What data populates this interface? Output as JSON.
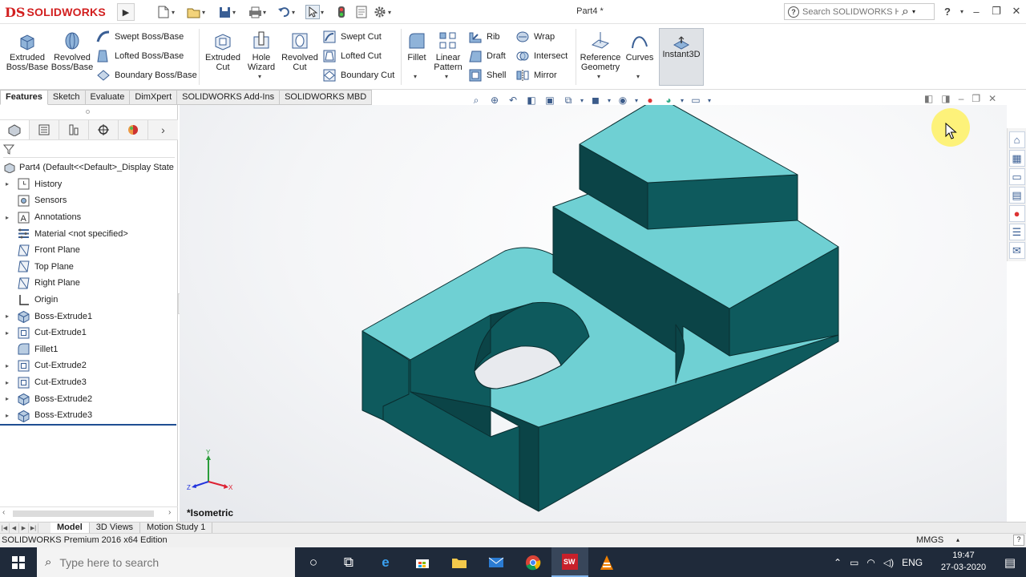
{
  "app": {
    "logo_ds": "DS",
    "logo_text": "SOLIDWORKS",
    "document_title": "Part4 *",
    "help_search_placeholder": "Search SOLIDWORKS Help",
    "help_label": "?",
    "accent_color": "#d21f1f"
  },
  "ribbon": {
    "extruded_boss": "Extruded\nBoss/Base",
    "revolved_boss": "Revolved\nBoss/Base",
    "swept_boss": "Swept Boss/Base",
    "lofted_boss": "Lofted Boss/Base",
    "boundary_boss": "Boundary Boss/Base",
    "extruded_cut": "Extruded\nCut",
    "hole_wizard": "Hole\nWizard",
    "revolved_cut": "Revolved\nCut",
    "swept_cut": "Swept Cut",
    "lofted_cut": "Lofted Cut",
    "boundary_cut": "Boundary Cut",
    "fillet": "Fillet",
    "linear_pattern": "Linear\nPattern",
    "rib": "Rib",
    "draft": "Draft",
    "shell": "Shell",
    "wrap": "Wrap",
    "intersect": "Intersect",
    "mirror": "Mirror",
    "reference_geometry": "Reference\nGeometry",
    "curves": "Curves",
    "instant3d": "Instant3D"
  },
  "tabs": [
    "Features",
    "Sketch",
    "Evaluate",
    "DimXpert",
    "SOLIDWORKS Add-Ins",
    "SOLIDWORKS MBD"
  ],
  "feature_tree": {
    "root": "Part4  (Default<<Default>_Display State",
    "items": [
      {
        "label": "History",
        "icon": "history-icon",
        "expandable": true
      },
      {
        "label": "Sensors",
        "icon": "sensors-icon",
        "expandable": false
      },
      {
        "label": "Annotations",
        "icon": "annotations-icon",
        "expandable": true
      },
      {
        "label": "Material <not specified>",
        "icon": "material-icon",
        "expandable": false
      },
      {
        "label": "Front Plane",
        "icon": "plane-icon",
        "expandable": false
      },
      {
        "label": "Top Plane",
        "icon": "plane-icon",
        "expandable": false
      },
      {
        "label": "Right Plane",
        "icon": "plane-icon",
        "expandable": false
      },
      {
        "label": "Origin",
        "icon": "origin-icon",
        "expandable": false
      },
      {
        "label": "Boss-Extrude1",
        "icon": "boss-extrude-icon",
        "expandable": true
      },
      {
        "label": "Cut-Extrude1",
        "icon": "cut-extrude-icon",
        "expandable": true
      },
      {
        "label": "Fillet1",
        "icon": "fillet-icon",
        "expandable": false
      },
      {
        "label": "Cut-Extrude2",
        "icon": "cut-extrude-icon",
        "expandable": true
      },
      {
        "label": "Cut-Extrude3",
        "icon": "cut-extrude-icon",
        "expandable": true
      },
      {
        "label": "Boss-Extrude2",
        "icon": "boss-extrude-icon",
        "expandable": true
      },
      {
        "label": "Boss-Extrude3",
        "icon": "boss-extrude-icon",
        "expandable": true
      }
    ]
  },
  "viewport": {
    "view_name": "*Isometric",
    "model_top_color": "#6fd0d3",
    "model_side_color": "#0e5a5d",
    "model_dark_color": "#0b4447",
    "triad": {
      "x": "X",
      "y": "Y",
      "z": "Z"
    }
  },
  "bottom_tabs": [
    "Model",
    "3D Views",
    "Motion Study 1"
  ],
  "status": {
    "edition": "SOLIDWORKS Premium 2016 x64 Edition",
    "units": "MMGS"
  },
  "taskbar": {
    "search_placeholder": "Type here to search",
    "language": "ENG",
    "time": "19:47",
    "date": "27-03-2020"
  }
}
